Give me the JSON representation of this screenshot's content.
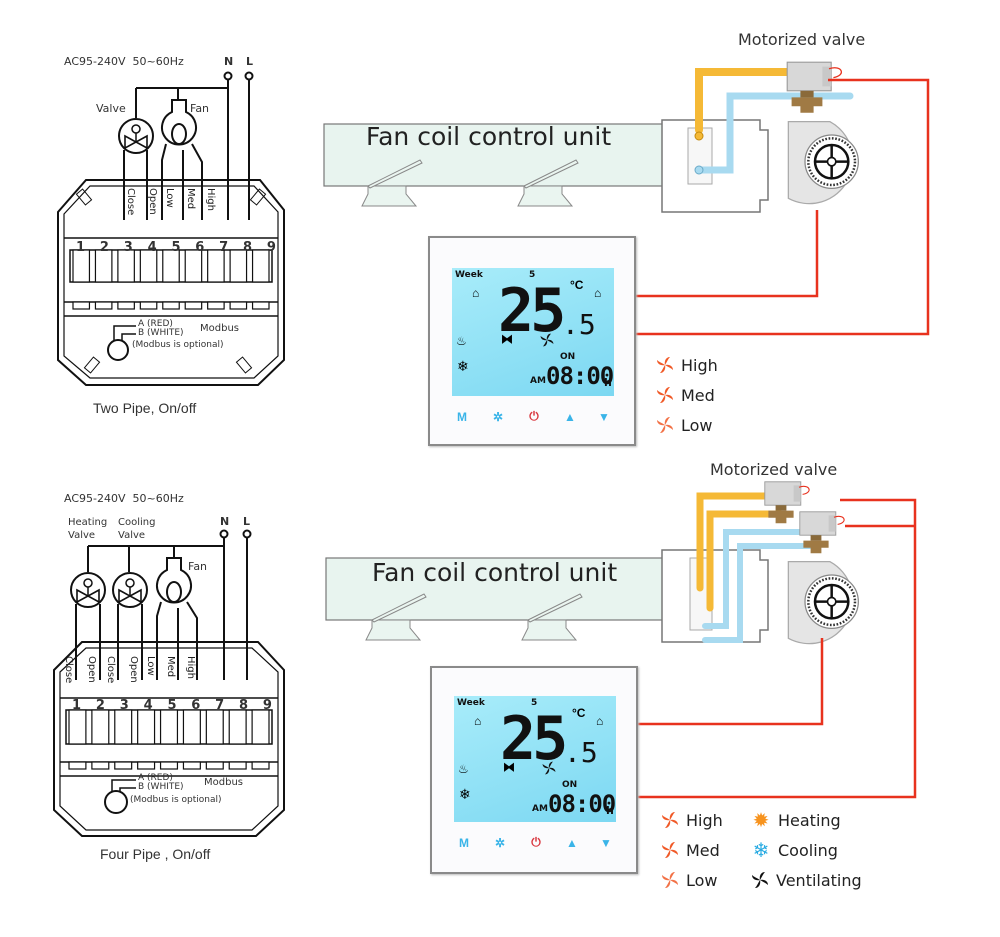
{
  "diagrams": [
    {
      "id": "two-pipe",
      "wiring": {
        "power_label": "AC95-240V  50~60Hz",
        "neutral_label": "N",
        "live_label": "L",
        "valve_labels": [
          "Valve"
        ],
        "fan_label": "Fan",
        "terminal_functions": [
          "Close",
          "Open",
          "Low",
          "Med",
          "High"
        ],
        "terminal_numbers": [
          "1",
          "2",
          "3",
          "4",
          "5",
          "6",
          "7",
          "8",
          "9"
        ],
        "modbus": {
          "a_label": "A (RED)",
          "b_label": "B (WHITE)",
          "title": "Modbus",
          "note": "(Modbus is optional)"
        },
        "caption": "Two Pipe, On/off"
      },
      "fcu_label": "Fan coil control unit",
      "valve_label": "Motorized valve",
      "thermostat": {
        "week_label": "Week",
        "day": "5",
        "temperature": "25",
        "temperature_decimal": ".5",
        "unit": "°C",
        "on_label": "ON",
        "ampm": "AM",
        "time": "08:00",
        "time_suffix": "h",
        "buttons": [
          "M",
          "fan",
          "power",
          "up",
          "down"
        ]
      },
      "legend": [
        {
          "icon": "fan-high-icon",
          "label": "High"
        },
        {
          "icon": "fan-med-icon",
          "label": "Med"
        },
        {
          "icon": "fan-low-icon",
          "label": "Low"
        }
      ]
    },
    {
      "id": "four-pipe",
      "wiring": {
        "power_label": "AC95-240V  50~60Hz",
        "neutral_label": "N",
        "live_label": "L",
        "valve_labels": [
          "Heating\nValve",
          "Cooling\nValve"
        ],
        "heating_valve_line1": "Heating",
        "heating_valve_line2": "Valve",
        "cooling_valve_line1": "Cooling",
        "cooling_valve_line2": "Valve",
        "fan_label": "Fan",
        "terminal_functions": [
          "Close",
          "Open",
          "Close",
          "Open",
          "Low",
          "Med",
          "High"
        ],
        "terminal_numbers": [
          "1",
          "2",
          "3",
          "4",
          "5",
          "6",
          "7",
          "8",
          "9"
        ],
        "modbus": {
          "a_label": "A (RED)",
          "b_label": "B (WHITE)",
          "title": "Modbus",
          "note": "(Modbus is optional)"
        },
        "caption": "Four Pipe , On/off"
      },
      "fcu_label": "Fan coil control unit",
      "valve_label": "Motorized valve",
      "thermostat": {
        "week_label": "Week",
        "day": "5",
        "temperature": "25",
        "temperature_decimal": ".5",
        "unit": "°C",
        "on_label": "ON",
        "ampm": "AM",
        "time": "08:00",
        "time_suffix": "h",
        "buttons": [
          "M",
          "fan",
          "power",
          "up",
          "down"
        ]
      },
      "legend": [
        {
          "icon": "fan-high-icon",
          "label": "High"
        },
        {
          "icon": "fan-med-icon",
          "label": "Med"
        },
        {
          "icon": "fan-low-icon",
          "label": "Low"
        },
        {
          "icon": "heating-sun-icon",
          "label": "Heating"
        },
        {
          "icon": "cooling-snowflake-icon",
          "label": "Cooling"
        },
        {
          "icon": "ventilating-fan-icon",
          "label": "Ventilating"
        }
      ]
    }
  ],
  "colors": {
    "wire_red": "#e8321e",
    "hot_pipe": "#f5b936",
    "cold_pipe": "#a8daf0",
    "fan_orange": "#f05a28",
    "heating_orange": "#f7931e",
    "cooling_blue": "#29abe2",
    "lcd_blue": "#8ee0f5",
    "button_blue": "#3ab4e8",
    "button_red": "#d9363e"
  }
}
